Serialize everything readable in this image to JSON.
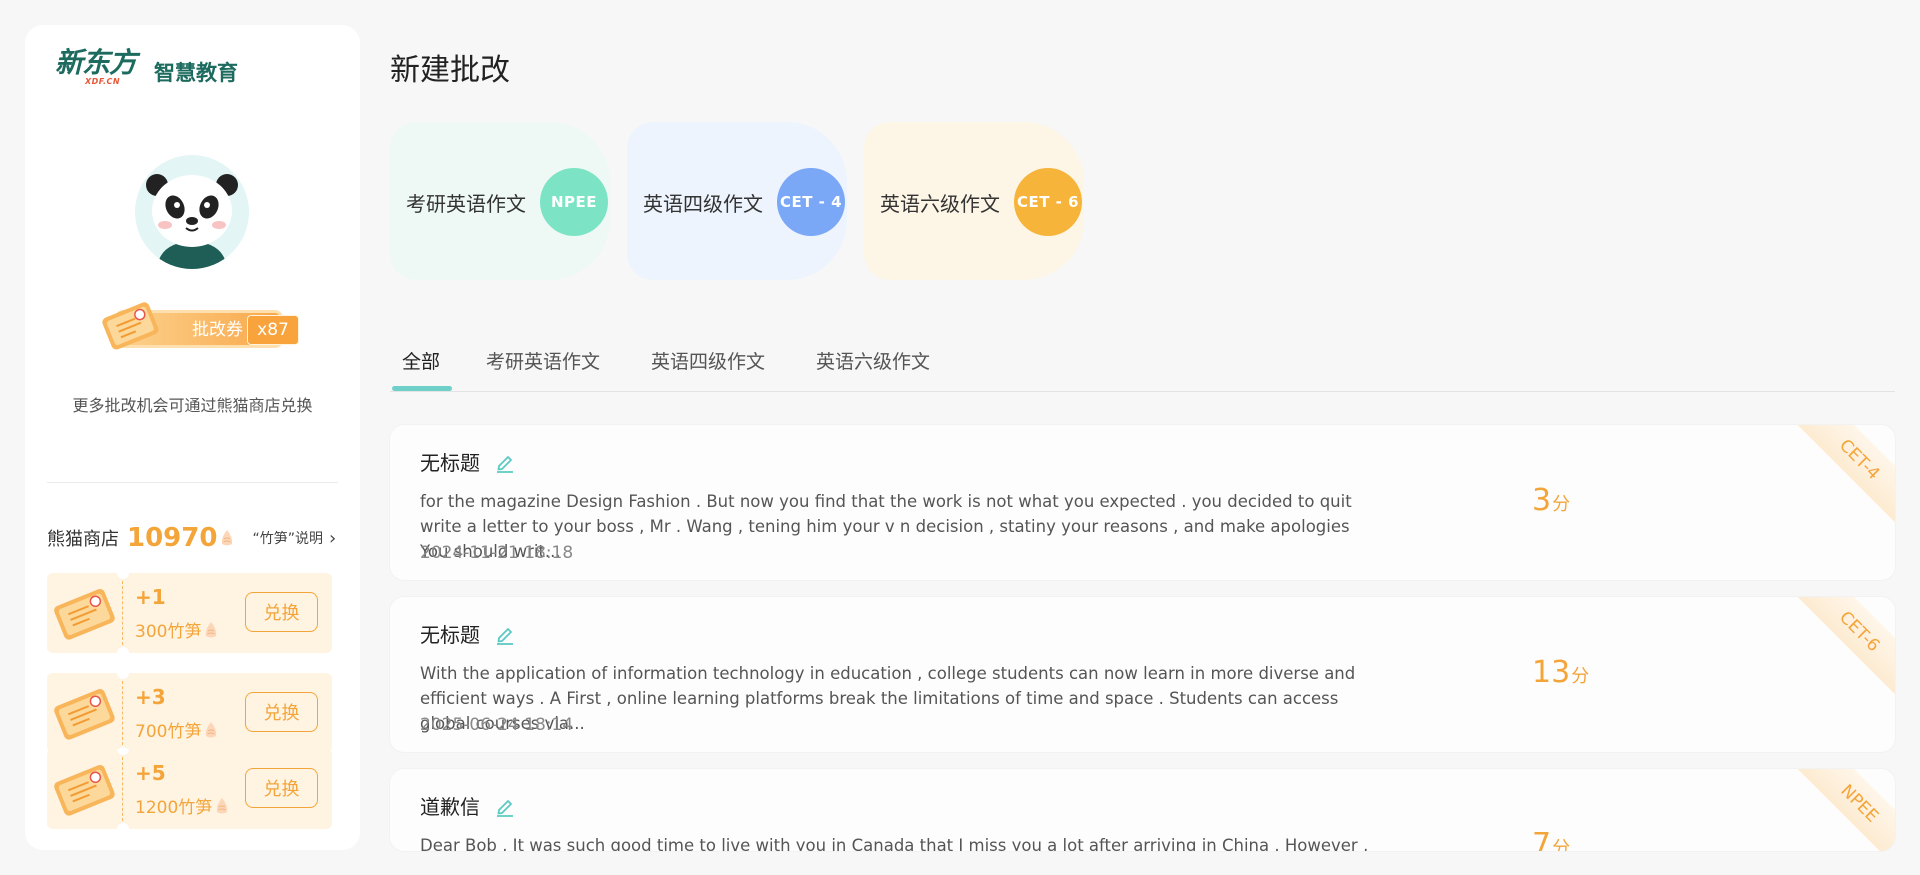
{
  "sidebar": {
    "logo_main": "新东方",
    "logo_sub": "XDF.CN",
    "logo_edu": "智慧教育",
    "voucher_label": "批改券",
    "voucher_count": "x87",
    "voucher_tip": "更多批改机会可通过熊猫商店兑换",
    "shop": {
      "title": "熊猫商店",
      "points": "10970",
      "explain": "“竹笋”说明",
      "chevron": "›",
      "items": [
        {
          "plus": "+1",
          "cost": "300竹笋",
          "button": "兑换"
        },
        {
          "plus": "+3",
          "cost": "700竹笋",
          "button": "兑换"
        },
        {
          "plus": "+5",
          "cost": "1200竹笋",
          "button": "兑换"
        }
      ]
    }
  },
  "main": {
    "title": "新建批改",
    "categories": [
      {
        "label": "考研英语作文",
        "badge": "NPEE",
        "bg": "#eef9f5",
        "badge_color": "#7ce4c5"
      },
      {
        "label": "英语四级作文",
        "badge": "CET - 4",
        "bg": "#eef4fd",
        "badge_color": "#7aa7f6"
      },
      {
        "label": "英语六级作文",
        "badge": "CET - 6",
        "bg": "#fdf6e6",
        "badge_color": "#f6b43a"
      }
    ],
    "tabs": [
      "全部",
      "考研英语作文",
      "英语四级作文",
      "英语六级作文"
    ],
    "records": [
      {
        "title": "无标题",
        "body": "for the magazine Design Fashion . But now you find that the work is not what you expected . you decided to quit write a letter to your boss , Mr . Wang , tening him your v n decision , statiny your reasons , and make apologies You should writ...",
        "date": "2024-11-21 18:18",
        "score": "3",
        "unit": "分",
        "tag": "CET-4"
      },
      {
        "title": "无标题",
        "body": "With the application of information technology in education , college students can now learn in more diverse and efficient ways . A First , online learning platforms break the limitations of time and space . Students can access global courses via...",
        "date": "2025-06-24 18:14",
        "score": "13",
        "unit": "分",
        "tag": "CET-6"
      },
      {
        "title": "道歉信",
        "body": "Dear Bob , It was such good time to live with you in Canada that I miss you a lot after arriving in China . However , I am",
        "date": "",
        "score": "7",
        "unit": "分",
        "tag": "NPEE"
      }
    ]
  },
  "colors": {
    "accent_orange": "#f4a53a",
    "accent_teal": "#6fd0c9",
    "brand_green": "#1d6b5f"
  }
}
